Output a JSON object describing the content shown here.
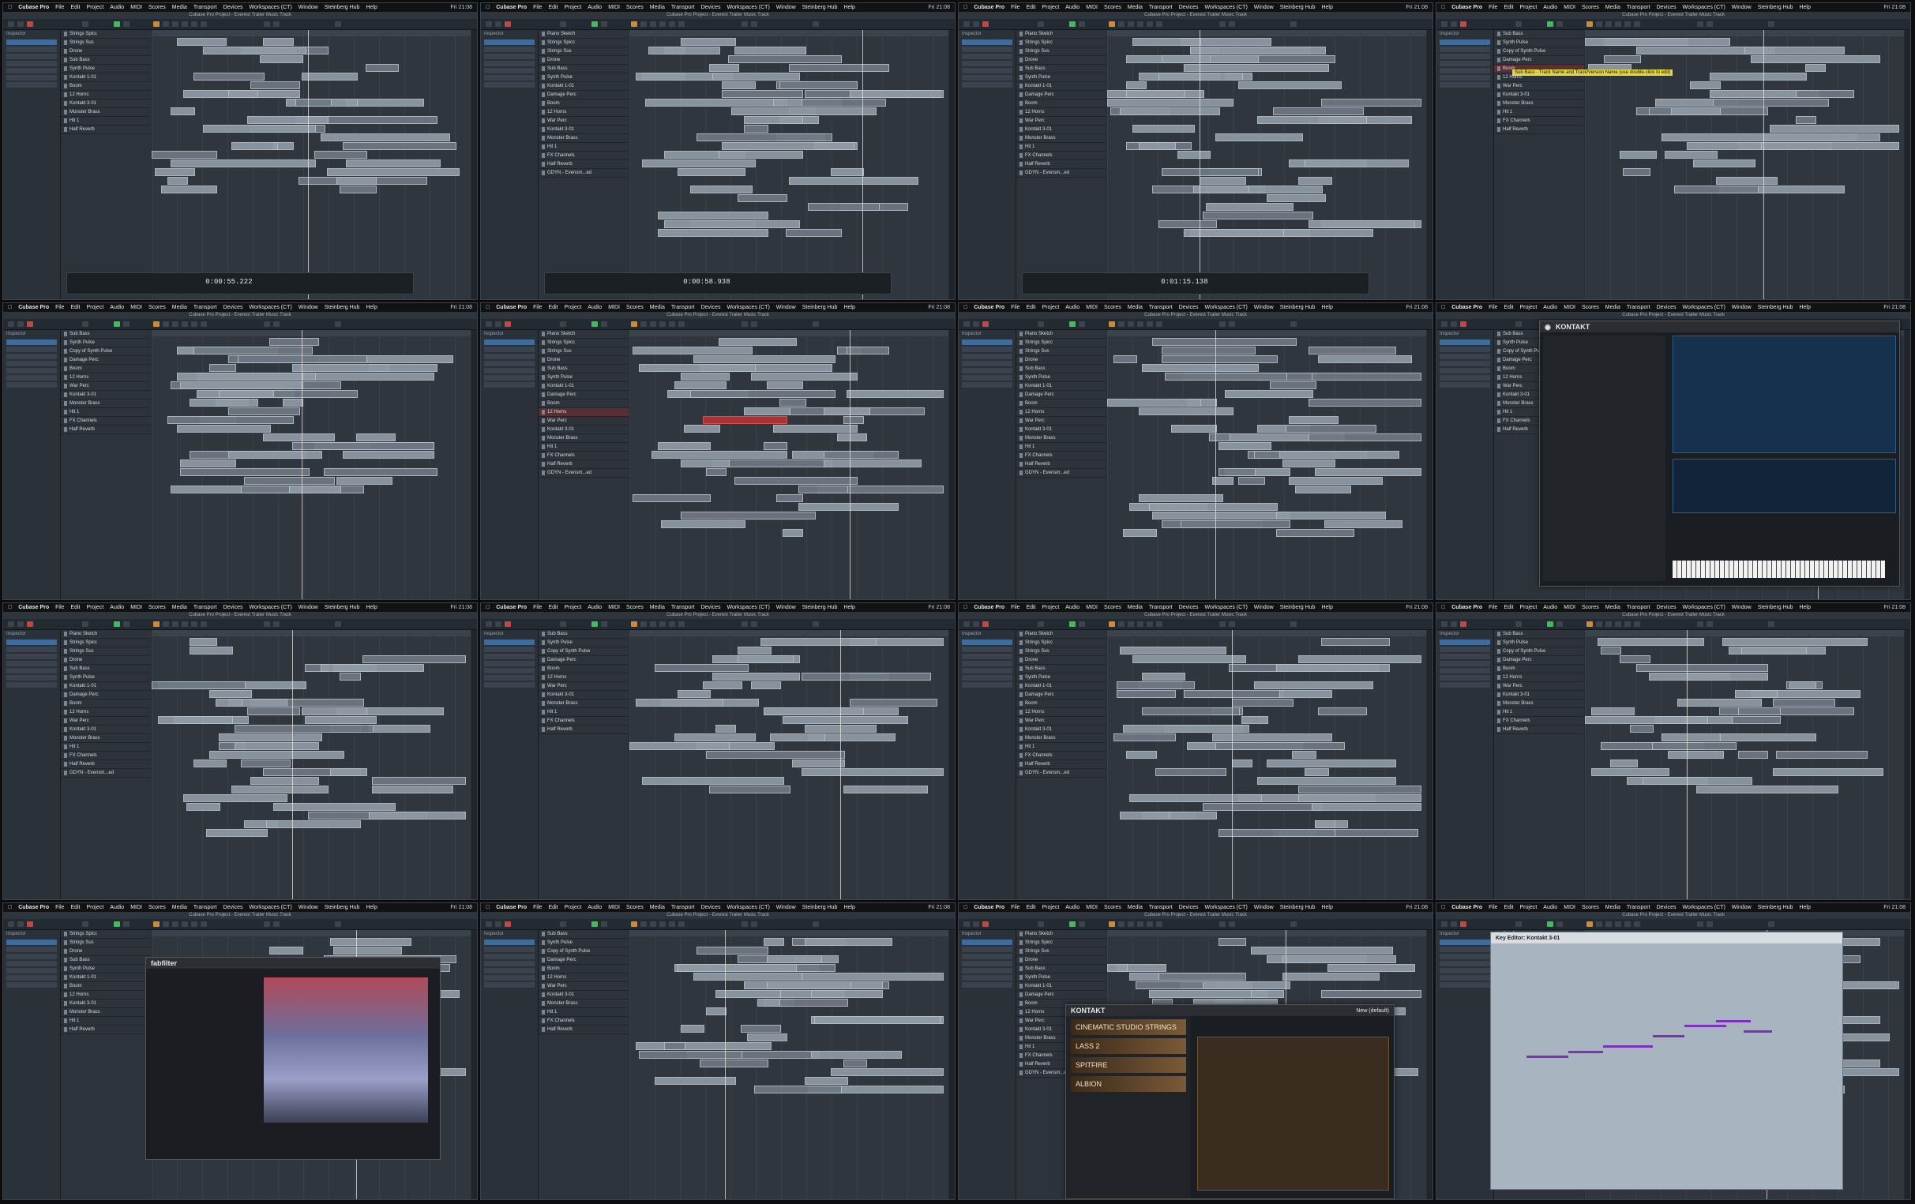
{
  "menu": {
    "app": "Cubase Pro",
    "items": [
      "File",
      "Edit",
      "Project",
      "Audio",
      "MIDI",
      "Scores",
      "Media",
      "Transport",
      "Devices",
      "Workspaces (CT)",
      "Window",
      "Steinberg Hub",
      "Help"
    ],
    "clock": "Fri 21:08"
  },
  "window_title": "Cubase Pro Project - Everest Trailer Music Track",
  "inspector": {
    "tab1": "Inspector",
    "tab2": "Visibility"
  },
  "tracks_a": [
    "Strings Spicc",
    "Strings Sus",
    "Drone",
    "Sub Bass",
    "Synth Pulse",
    "Kontakt 1-01",
    "Boom",
    "12 Horns",
    "Kontakt 3-01",
    "Monster Brass",
    "Hit 1",
    "Half Reverb"
  ],
  "tracks_b": [
    "Piano Sketch",
    "Strings Spicc",
    "Strings Sus",
    "Drone",
    "Sub Bass",
    "Synth Pulse",
    "Kontakt 1-01",
    "Damage Perc",
    "Boom",
    "12 Horns",
    "War Perc",
    "Kontakt 3-01",
    "Monster Brass",
    "Hit 1",
    "FX Channels",
    "Half Reverb",
    "GDYN - Evensm...ed"
  ],
  "tracks_c": [
    "Sub Bass",
    "Synth Pulse",
    "Copy of Synth Pulse",
    "Damage Perc",
    "Boom",
    "12 Horns",
    "War Perc",
    "Kontakt 3-01",
    "Monster Brass",
    "Hit 1",
    "FX Channels",
    "Half Reverb"
  ],
  "timecodes": [
    "0:00:55.222",
    "0:00:58.938",
    "0:01:15.138"
  ],
  "tooltip": "Sub Bass - Track Name and Track/Version Name (use double-click to edit)",
  "part_label": "Kontakt 1-01",
  "kontakt": {
    "title": "KONTAKT",
    "preset": "New (default)",
    "tile1": "CINEMATIC STUDIO STRINGS",
    "tile2": "LASS 2",
    "tile3": "SPITFIRE",
    "tile4": "ALBION"
  },
  "fabfilter": {
    "title": "fabfilter"
  },
  "key_editor": {
    "title": "Key Editor: Kontakt 3-01"
  },
  "colors": {
    "accent_green": "#3cbf56",
    "record_red": "#c6463f",
    "selected_track": "#5a2f34",
    "part": "#8f9aa5"
  }
}
